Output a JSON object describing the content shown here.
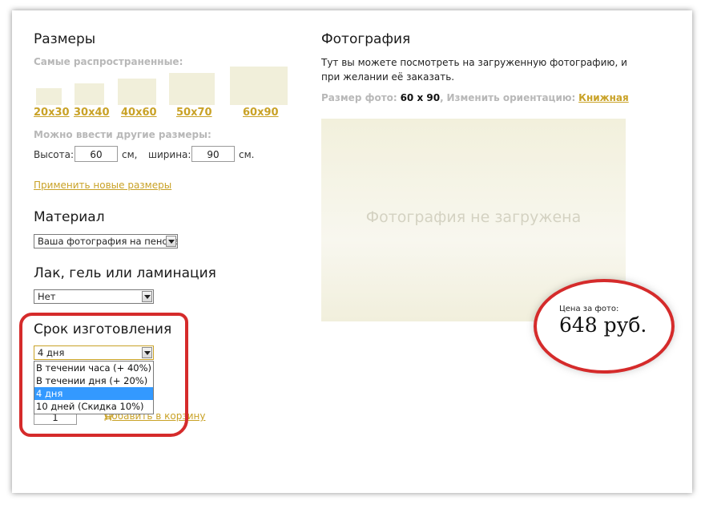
{
  "sizes": {
    "title": "Размеры",
    "common_label": "Самые распространенные:",
    "presets": [
      "20x30",
      "30x40",
      "40x60",
      "50x70",
      "60x90"
    ],
    "custom_label": "Можно ввести другие размеры:",
    "height_label": "Высота:",
    "height_value": "60",
    "height_unit": "см,",
    "width_label": "ширина:",
    "width_value": "90",
    "width_unit": "см.",
    "apply_link": "Применить новые размеры"
  },
  "material": {
    "title": "Материал",
    "selected": "Ваша фотография на пенокартоне"
  },
  "coating": {
    "title": "Лак, гель или ламинация",
    "selected": "Нет"
  },
  "production": {
    "title": "Срок изготовления",
    "selected": "4 дня",
    "options": [
      "В течении часа (+ 40%)",
      "В течении дня (+ 20%)",
      "4 дня",
      "10 дней (Скидка 10%)"
    ],
    "selected_index": 2
  },
  "cart": {
    "quantity": "1",
    "add_link": "Добавить в корзину",
    "icon": "cart-icon"
  },
  "photo": {
    "title": "Фотография",
    "description": "Тут вы можете посмотреть на загруженную фотографию, и при желании её заказать.",
    "size_label": "Размер фото:",
    "size_value": "60 х 90",
    "orientation_label": "Изменить ориентацию:",
    "orientation_value": "Книжная",
    "placeholder": "Фотография не загружена"
  },
  "price": {
    "label": "Цена за фото:",
    "value": "648 руб."
  },
  "colors": {
    "accent_link": "#c9a227",
    "highlight": "#d52b2b",
    "selected_option": "#3399ff"
  }
}
